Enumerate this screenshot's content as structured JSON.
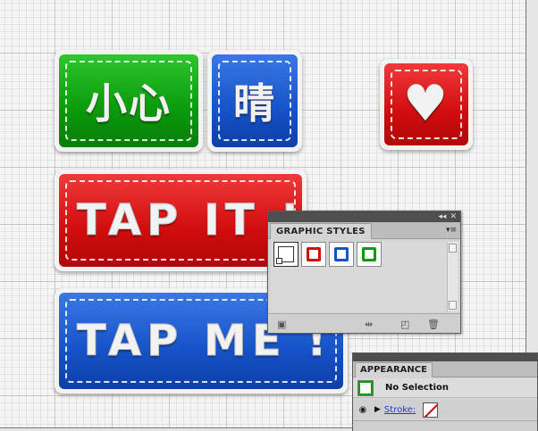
{
  "canvas": {
    "stickers": [
      {
        "name": "sticker-caution",
        "text": "小心",
        "color": "green"
      },
      {
        "name": "sticker-sunny",
        "text": "晴",
        "color": "blue"
      },
      {
        "name": "sticker-heart",
        "text": "♥",
        "color": "red"
      },
      {
        "name": "sticker-tap-it",
        "text": "TAP IT !",
        "color": "red"
      },
      {
        "name": "sticker-tap-me",
        "text": "TAP ME !",
        "color": "blue"
      }
    ]
  },
  "graphic_styles_panel": {
    "title": "GRAPHIC STYLES",
    "collapse_icon": "double-arrow-icon",
    "close_icon": "close-icon",
    "menu_icon": "panel-menu-icon",
    "swatches": [
      {
        "name": "default-style",
        "border_color": "#000000"
      },
      {
        "name": "red-style",
        "border_color": "#d10d0d"
      },
      {
        "name": "blue-style",
        "border_color": "#1652c8"
      },
      {
        "name": "green-style",
        "border_color": "#0a9a0a"
      }
    ],
    "footer_icons": [
      "graphic-style-libraries-icon",
      "break-link-icon",
      "new-style-icon",
      "delete-icon"
    ]
  },
  "appearance_panel": {
    "title": "APPEARANCE",
    "selection_label": "No Selection",
    "stroke_label": "Stroke:",
    "thumb_color": "#0a9a0a"
  },
  "colors": {
    "green": "#0a9a0a",
    "blue": "#1652c8",
    "red": "#d10d0d"
  }
}
